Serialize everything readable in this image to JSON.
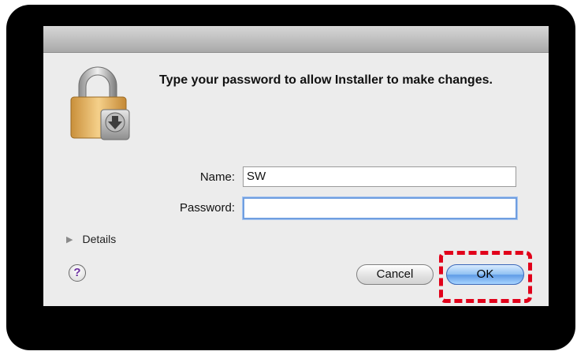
{
  "dialog": {
    "message": "Type your password to allow Installer to make changes.",
    "name_label": "Name:",
    "name_value": "SW",
    "password_label": "Password:",
    "password_value": "",
    "details_label": "Details",
    "help_label": "?",
    "cancel_label": "Cancel",
    "ok_label": "OK",
    "icon": "lock-installer-icon"
  },
  "annotation": {
    "highlight_color": "#e1001a"
  }
}
